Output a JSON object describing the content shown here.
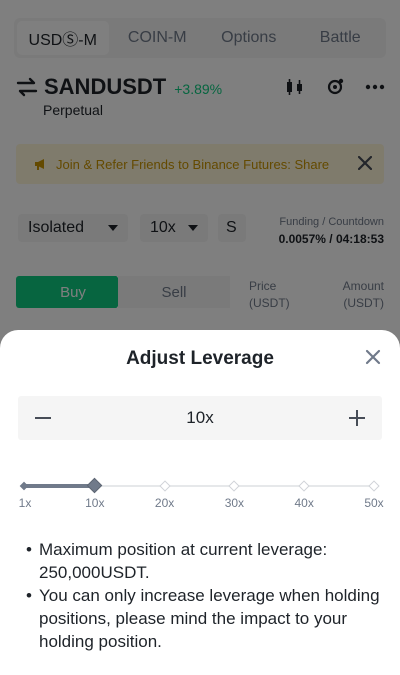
{
  "tabs": [
    {
      "label": "USDⓈ-M",
      "active": true
    },
    {
      "label": "COIN-M",
      "active": false
    },
    {
      "label": "Options",
      "active": false
    },
    {
      "label": "Battle",
      "active": false
    }
  ],
  "pair": {
    "symbol": "SANDUSDT",
    "change": "+3.89%",
    "type": "Perpetual"
  },
  "banner": {
    "text": "Join & Refer Friends to Binance Futures: Share"
  },
  "order": {
    "margin_mode": "Isolated",
    "leverage": "10x",
    "size_mode": "S",
    "funding_label": "Funding / Countdown",
    "funding_value": "0.0057% / 04:18:53",
    "buy_label": "Buy",
    "sell_label": "Sell",
    "price_header": "Price",
    "price_unit": "(USDT)",
    "amount_header": "Amount",
    "amount_unit": "(USDT)"
  },
  "modal": {
    "title": "Adjust Leverage",
    "value": "10x",
    "slider_value": 10,
    "ticks": [
      "1x",
      "10x",
      "20x",
      "30x",
      "40x",
      "50x"
    ],
    "notes": [
      "Maximum position at current leverage: 250,000USDT.",
      "You can only increase leverage when holding positions, please mind the impact to your holding position."
    ]
  },
  "colors": {
    "accent_green": "#0ecb81",
    "banner_text": "#c99400",
    "slider": "#707a8a"
  },
  "icons": {
    "swap": "swap-arrows-icon",
    "chart": "candlestick-icon",
    "cycle": "refresh-icon",
    "more": "more-dots-icon",
    "megaphone": "megaphone-icon",
    "close": "close-icon",
    "minus": "minus-icon",
    "plus": "plus-icon"
  }
}
